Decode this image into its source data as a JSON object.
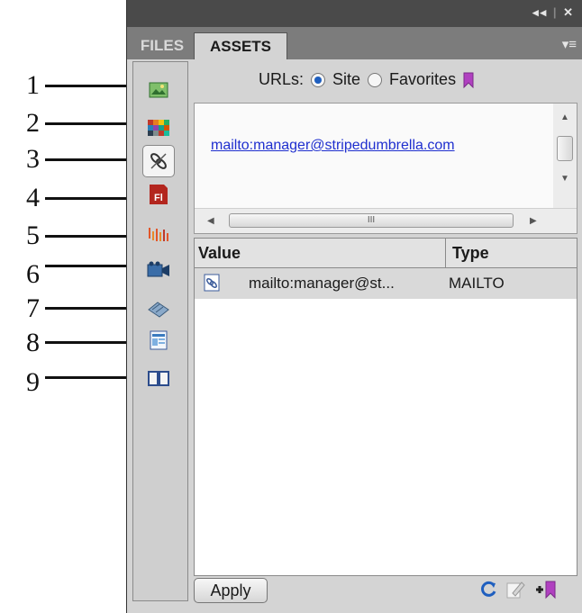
{
  "callouts": [
    "1",
    "2",
    "3",
    "4",
    "5",
    "6",
    "7",
    "8",
    "9"
  ],
  "panel": {
    "tabs": [
      {
        "label": "FILES"
      },
      {
        "label": "ASSETS"
      }
    ]
  },
  "categories": [
    {
      "name": "images",
      "icon": "images-icon"
    },
    {
      "name": "colors",
      "icon": "colors-icon"
    },
    {
      "name": "urls",
      "icon": "urls-icon",
      "selected": true
    },
    {
      "name": "flash",
      "icon": "flash-icon",
      "glyph": "Fl"
    },
    {
      "name": "shockwave",
      "icon": "shockwave-icon"
    },
    {
      "name": "movies",
      "icon": "movies-icon"
    },
    {
      "name": "scripts",
      "icon": "scripts-icon"
    },
    {
      "name": "templates",
      "icon": "templates-icon"
    },
    {
      "name": "library",
      "icon": "library-icon"
    }
  ],
  "urls_filter": {
    "label": "URLs:",
    "options": [
      "Site",
      "Favorites"
    ],
    "selected": "Site"
  },
  "preview": {
    "link": "mailto:manager@stripedumbrella.com",
    "scroll_grip": "III"
  },
  "table": {
    "columns": [
      "Value",
      "Type"
    ],
    "rows": [
      {
        "value": "mailto:manager@st...",
        "type": "MAILTO"
      }
    ]
  },
  "footer": {
    "apply_label": "Apply"
  },
  "colors": {
    "accent": "#1f5fbf",
    "link": "#1f2fcf",
    "favorites": "#b040c0"
  }
}
